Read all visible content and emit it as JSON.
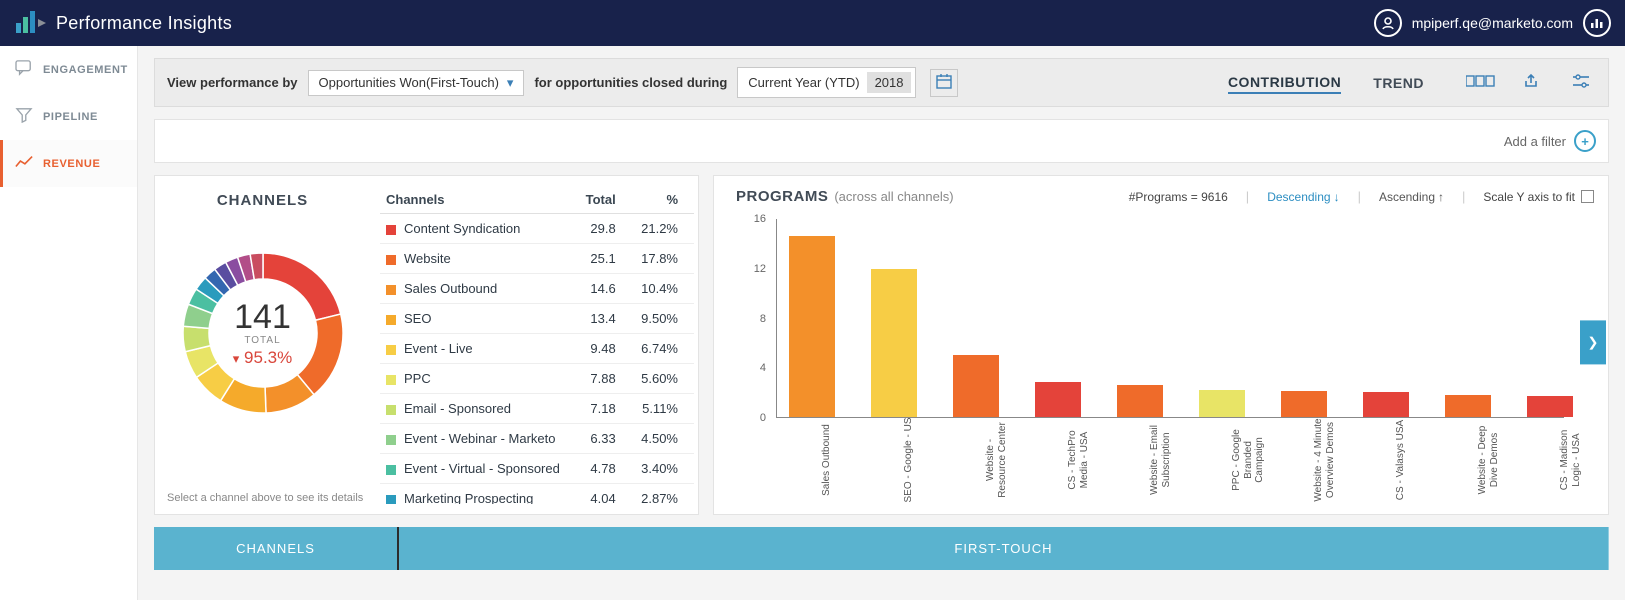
{
  "header": {
    "app_title": "Performance Insights",
    "user_email": "mpiperf.qe@marketo.com"
  },
  "sidebar": {
    "items": [
      {
        "label": "ENGAGEMENT"
      },
      {
        "label": "PIPELINE"
      },
      {
        "label": "REVENUE"
      }
    ]
  },
  "filterbar": {
    "prefix": "View performance by",
    "metric": "Opportunities Won(First-Touch)",
    "middle": "for opportunities closed during",
    "period": "Current Year (YTD)",
    "year": "2018",
    "tab_contribution": "CONTRIBUTION",
    "tab_trend": "TREND"
  },
  "filterstrip": {
    "add_filter": "Add a filter"
  },
  "channels_panel": {
    "title": "CHANNELS",
    "headers": {
      "c1": "Channels",
      "c2": "Total",
      "c3": "%"
    },
    "center_value": "141",
    "center_label": "TOTAL",
    "center_pct": "95.3%",
    "footer": "Select a channel above to see its details",
    "rows": [
      {
        "color": "#e4433a",
        "name": "Content Syndication",
        "total": "29.8",
        "pct": "21.2%"
      },
      {
        "color": "#ef6b2a",
        "name": "Website",
        "total": "25.1",
        "pct": "17.8%"
      },
      {
        "color": "#f3902a",
        "name": "Sales Outbound",
        "total": "14.6",
        "pct": "10.4%"
      },
      {
        "color": "#f5aa2b",
        "name": "SEO",
        "total": "13.4",
        "pct": "9.50%"
      },
      {
        "color": "#f7cd45",
        "name": "Event - Live",
        "total": "9.48",
        "pct": "6.74%"
      },
      {
        "color": "#e8e466",
        "name": "PPC",
        "total": "7.88",
        "pct": "5.60%"
      },
      {
        "color": "#c7df6d",
        "name": "Email - Sponsored",
        "total": "7.18",
        "pct": "5.11%"
      },
      {
        "color": "#8fcf8d",
        "name": "Event - Webinar - Marketo",
        "total": "6.33",
        "pct": "4.50%"
      },
      {
        "color": "#4bbfa1",
        "name": "Event - Virtual - Sponsored",
        "total": "4.78",
        "pct": "3.40%"
      },
      {
        "color": "#2a9bbd",
        "name": "Marketing Prospecting",
        "total": "4.04",
        "pct": "2.87%"
      }
    ]
  },
  "chart_data": {
    "type": "bar",
    "title": "PROGRAMS",
    "subtitle": "(across all channels)",
    "count_label": "#Programs = 9616",
    "sort_desc": "Descending",
    "sort_asc": "Ascending",
    "scale_label": "Scale Y axis to fit",
    "y_ticks": [
      0,
      4,
      8,
      12,
      16
    ],
    "ylim": [
      0,
      16
    ],
    "categories": [
      "Sales Outbound",
      "SEO - Google - US",
      "Website - Resource Center",
      "CS - TechPro Media - USA",
      "Website - Email Subscription",
      "PPC - Google Branded Campaign",
      "Website - 4 Minute Overview Demos",
      "CS - Valasys USA",
      "Website - Deep Dive Demos",
      "CS - Madison Logic - USA"
    ],
    "values": [
      14.6,
      12.0,
      5.0,
      2.8,
      2.6,
      2.2,
      2.1,
      2.0,
      1.8,
      1.7
    ],
    "colors": [
      "#f3902a",
      "#f7cd45",
      "#ef6b2a",
      "#e4433a",
      "#ef6b2a",
      "#e8e466",
      "#ef6b2a",
      "#e4433a",
      "#ef6b2a",
      "#e4433a"
    ]
  },
  "bottom_tabs": {
    "left": "CHANNELS",
    "right": "FIRST-TOUCH"
  }
}
